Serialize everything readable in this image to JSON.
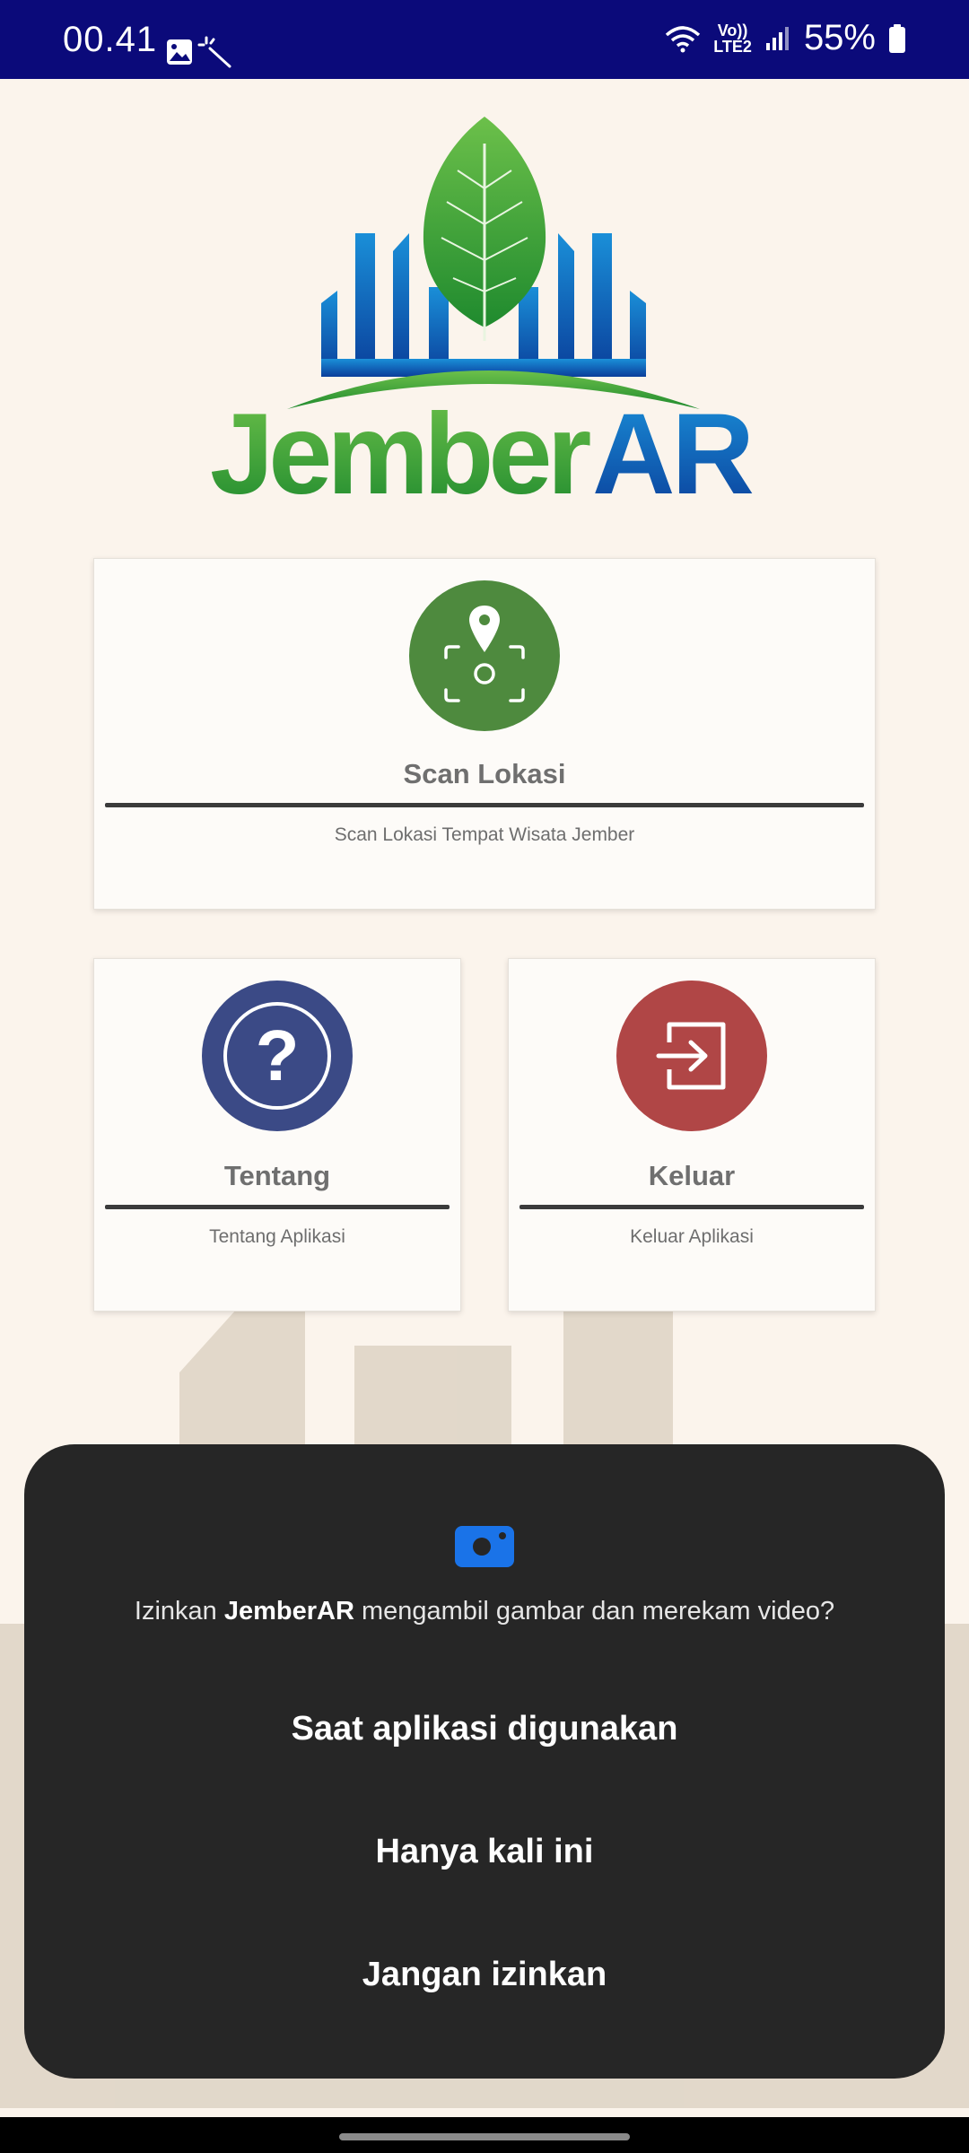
{
  "status_bar": {
    "time": "00.41",
    "network": "LTE2",
    "network_top": "Vo))",
    "battery": "55%",
    "icons": [
      "image-icon",
      "magic-wand-icon",
      "wifi-icon",
      "signal-icon",
      "battery-icon"
    ]
  },
  "logo": {
    "text_green": "Jember",
    "text_blue": "AR"
  },
  "cards": {
    "scan": {
      "title": "Scan Lokasi",
      "subtitle": "Scan Lokasi Tempat Wisata Jember",
      "icon": "location-scan-icon",
      "color": "#4E8A3E"
    },
    "about": {
      "title": "Tentang",
      "subtitle": "Tentang Aplikasi",
      "icon": "question-icon",
      "color": "#3B4A86"
    },
    "exit": {
      "title": "Keluar",
      "subtitle": "Keluar Aplikasi",
      "icon": "exit-icon",
      "color": "#B04646"
    }
  },
  "permission": {
    "prefix": "Izinkan ",
    "app_name": "JemberAR",
    "suffix": " mengambil gambar dan merekam video?",
    "options": {
      "while_using": "Saat aplikasi digunakan",
      "only_once": "Hanya kali ini",
      "deny": "Jangan izinkan"
    },
    "icon": "camera-icon",
    "accent": "#1A73E8"
  }
}
